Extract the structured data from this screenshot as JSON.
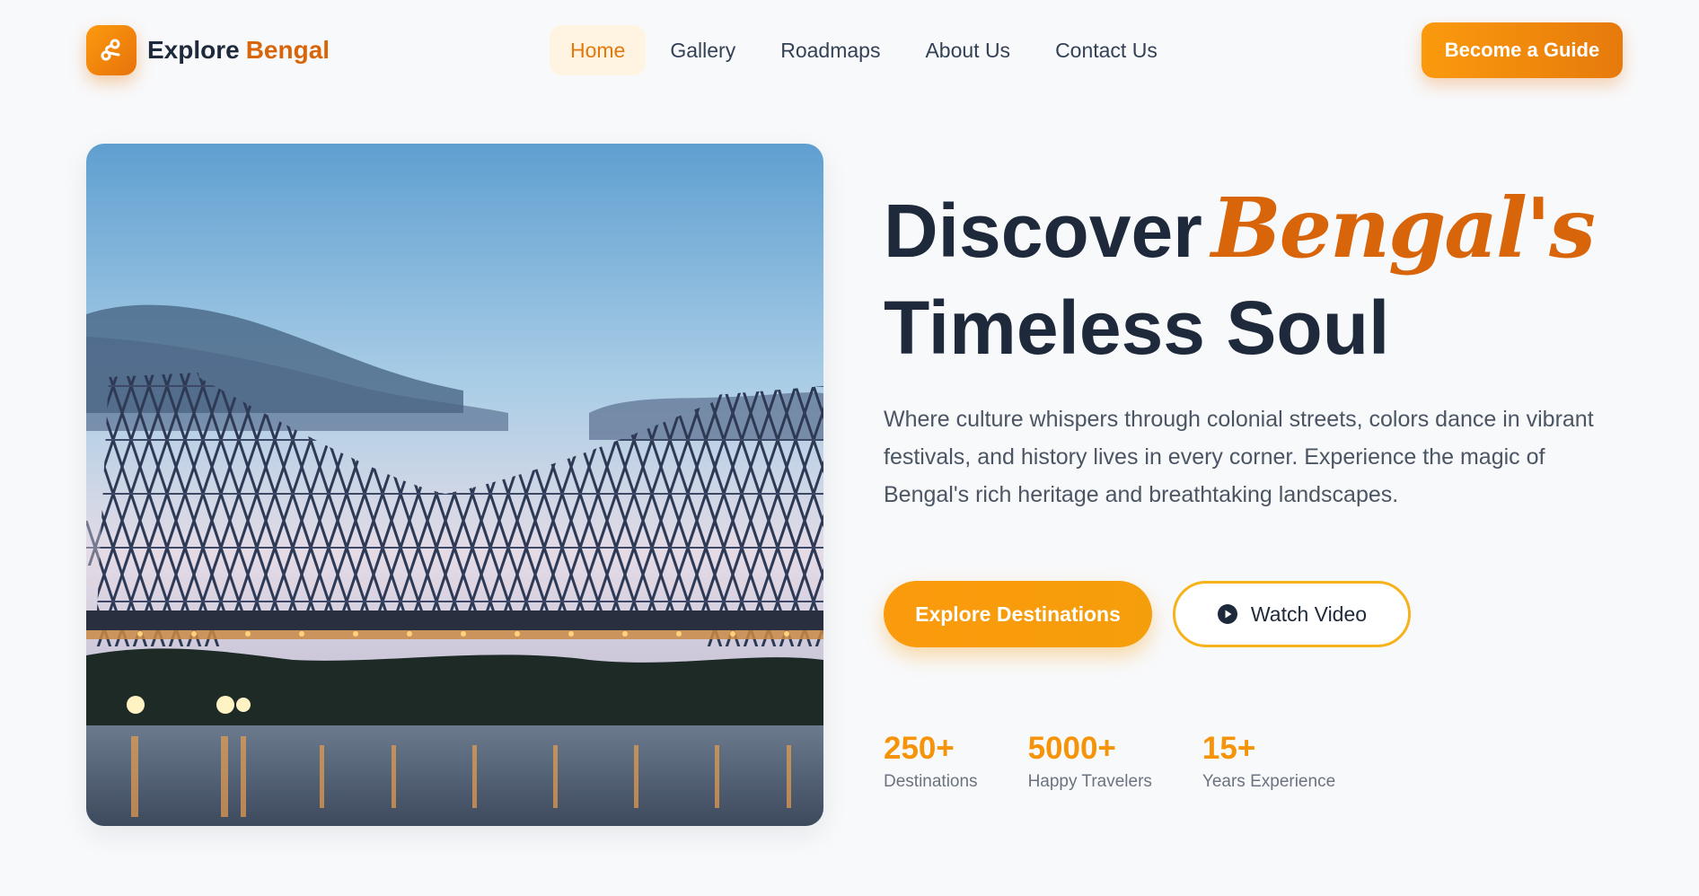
{
  "brand": {
    "name_part1": "Explore",
    "name_part2": "Bengal",
    "logo_icon": "route-icon"
  },
  "nav": {
    "items": [
      {
        "label": "Home",
        "active": true
      },
      {
        "label": "Gallery",
        "active": false
      },
      {
        "label": "Roadmaps",
        "active": false
      },
      {
        "label": "About Us",
        "active": false
      },
      {
        "label": "Contact Us",
        "active": false
      }
    ],
    "cta_label": "Become a Guide"
  },
  "hero": {
    "image_subject": "howrah-bridge-photo",
    "headline_part1": "Discover",
    "headline_script": "Bengal's",
    "headline_part2": "Timeless Soul",
    "lead": "Where culture whispers through colonial streets, colors dance in vibrant festivals, and history lives in every corner. Experience the magic of Bengal's rich heritage and breathtaking landscapes.",
    "primary_button": "Explore Destinations",
    "secondary_button": "Watch Video",
    "secondary_icon": "play-circle-icon",
    "stats": [
      {
        "value": "250+",
        "label": "Destinations"
      },
      {
        "value": "5000+",
        "label": "Happy Travelers"
      },
      {
        "value": "15+",
        "label": "Years Experience"
      }
    ]
  },
  "colors": {
    "accent": "#f59309",
    "accent_dark": "#d9650b",
    "text": "#1e2a3b",
    "muted": "#4b5563",
    "background": "#f8f9fb"
  }
}
